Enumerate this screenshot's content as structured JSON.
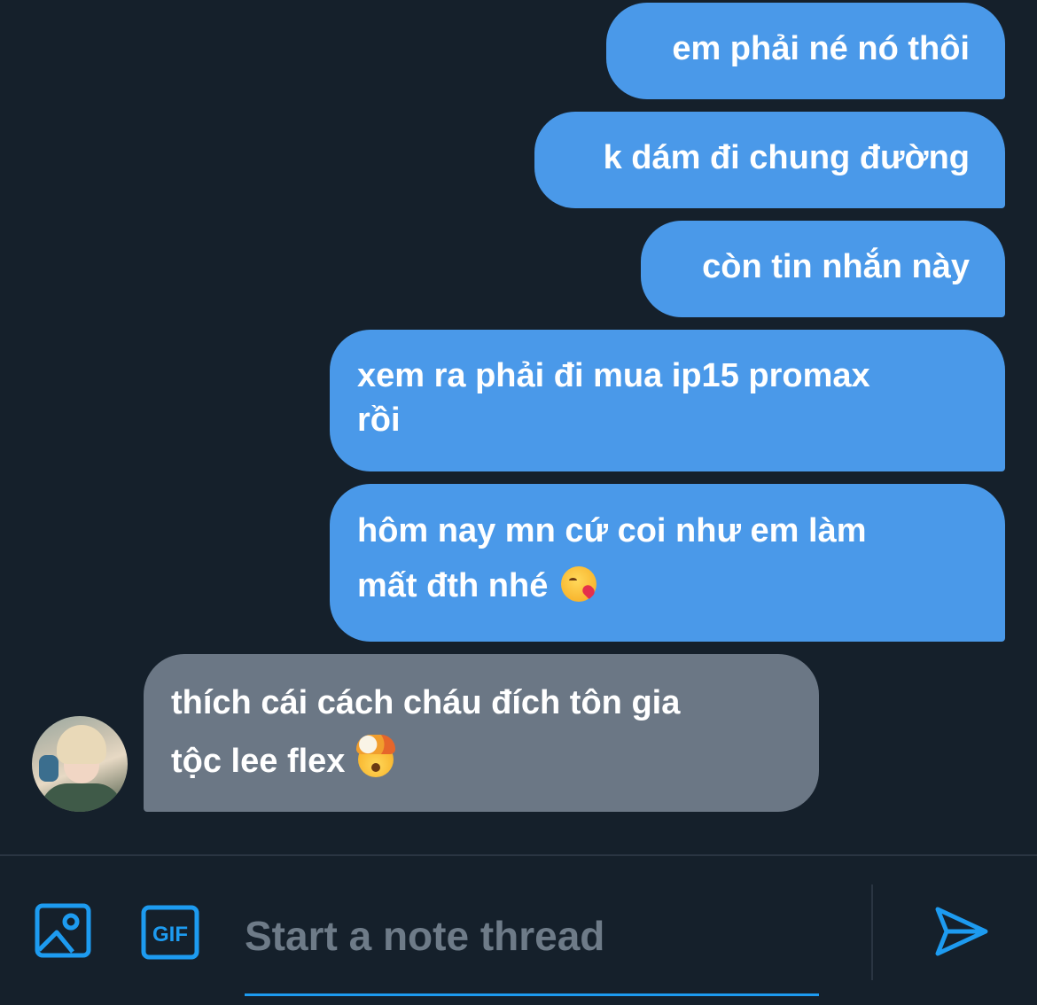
{
  "messages": [
    {
      "from": "me",
      "text": "em phải né nó thôi"
    },
    {
      "from": "me",
      "text": "k dám đi chung đường"
    },
    {
      "from": "me",
      "text": "còn tin nhắn này"
    },
    {
      "from": "me",
      "lines": [
        "xem ra phải đi mua ip15 promax",
        "rồi"
      ]
    },
    {
      "from": "me",
      "lines": [
        "hôm nay mn cứ coi như em làm",
        "mất đth nhé"
      ],
      "emoji": "face-blowing-kiss"
    },
    {
      "from": "other",
      "lines": [
        "thích cái cách cháu đích tôn gia",
        "tộc lee flex"
      ],
      "emoji": "exploding-head"
    }
  ],
  "composer": {
    "placeholder": "Start a note thread",
    "value": "",
    "gif_label": "GIF",
    "icons": [
      "image-icon",
      "gif-icon",
      "send-icon"
    ]
  },
  "colors": {
    "background": "#15202B",
    "sent_bubble": "#4A99E9",
    "received_bubble": "#6B7785",
    "accent": "#1D9BF0",
    "placeholder": "#6E7B88"
  }
}
